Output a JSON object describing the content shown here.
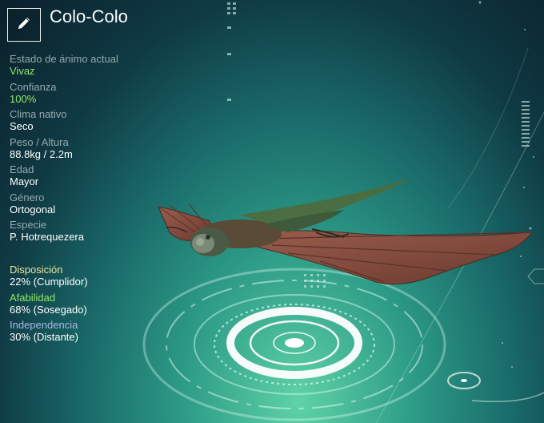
{
  "creature": {
    "name": "Colo-Colo"
  },
  "stats": [
    {
      "label": "Estado de ánimo actual",
      "value": "Vivaz"
    },
    {
      "label": "Confianza",
      "value": "100%"
    },
    {
      "label": "Clima nativo",
      "value": "Seco"
    },
    {
      "label": "Peso / Altura",
      "value": "88.8kg / 2.2m"
    },
    {
      "label": "Edad",
      "value": "Mayor"
    },
    {
      "label": "Género",
      "value": "Ortogonal"
    },
    {
      "label": "Especie",
      "value": "P. Hotrequezera"
    }
  ],
  "traits": [
    {
      "label": "Disposición",
      "value": "22% (Cumplidor)",
      "percent": 22
    },
    {
      "label": "Afabilidad",
      "value": "68% (Sosegado)",
      "percent": 68
    },
    {
      "label": "Independencia",
      "value": "30% (Distante)",
      "percent": 30
    }
  ],
  "colors": {
    "highlight_green": "#8fe86a",
    "disposition_label": "#e6e79a",
    "independence_label": "#a8b8e8",
    "creature_wing": "#7a4a3e",
    "creature_body": "#3e5a3a"
  },
  "icons": {
    "edit": "pencil-icon"
  }
}
